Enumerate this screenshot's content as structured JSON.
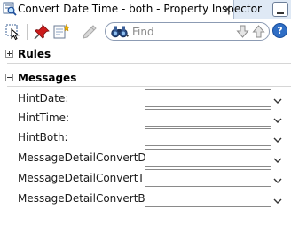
{
  "window": {
    "title": "Convert Date Time - both - Property Inspector",
    "close_glyph": "×",
    "icons": {
      "tab": "property-inspector-icon",
      "minimize": "minimize-icon"
    }
  },
  "toolbar": {
    "buttons": [
      "select-node-icon",
      "pin-icon",
      "edit-properties-icon",
      "pencil-icon"
    ],
    "search": {
      "placeholder": "Find",
      "value": ""
    },
    "help_label": "?"
  },
  "sections": {
    "rules": {
      "label": "Rules",
      "expanded": false
    },
    "messages": {
      "label": "Messages",
      "expanded": true
    }
  },
  "properties": [
    {
      "label": "HintDate:",
      "value": ""
    },
    {
      "label": "HintTime:",
      "value": ""
    },
    {
      "label": "HintBoth:",
      "value": ""
    },
    {
      "label": "MessageDetailConvertDate:",
      "value": ""
    },
    {
      "label": "MessageDetailConvertTime:",
      "value": ""
    },
    {
      "label": "MessageDetailConvertBoth:",
      "value": ""
    }
  ],
  "colors": {
    "titlebar": "#dfe9f5",
    "accent": "#2f6ec5",
    "pin": "#cc1b1b"
  }
}
